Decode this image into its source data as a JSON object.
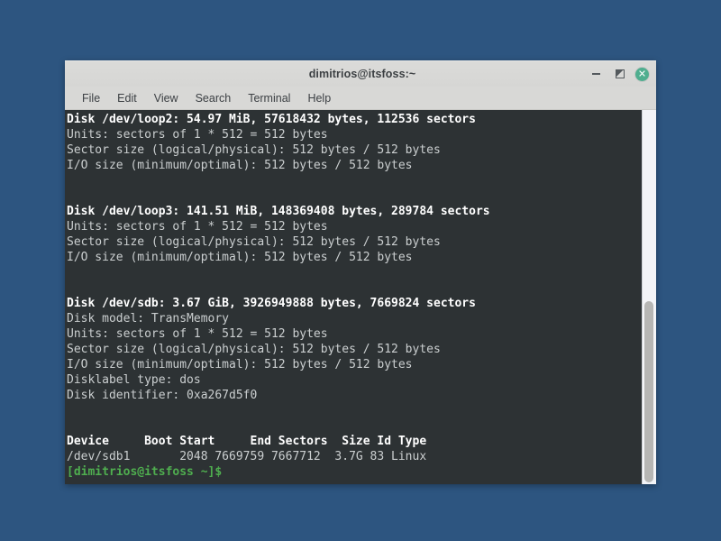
{
  "desktop": {
    "background_color": "#2d5580"
  },
  "window": {
    "title": "dimitrios@itsfoss:~",
    "titlebar_color": "#d8d8d6",
    "controls": {
      "minimize_label": "–",
      "maximize_label": "◤",
      "close_label": "✕",
      "close_color": "#4fae8f"
    },
    "menubar": {
      "items": [
        {
          "label": "File"
        },
        {
          "label": "Edit"
        },
        {
          "label": "View"
        },
        {
          "label": "Search"
        },
        {
          "label": "Terminal"
        },
        {
          "label": "Help"
        }
      ]
    }
  },
  "terminal": {
    "background_color": "#2d3234",
    "foreground_color": "#cfd2d2",
    "prompt_color": "#4fae4f",
    "lines": [
      {
        "text": "Disk /dev/loop2: 54.97 MiB, 57618432 bytes, 112536 sectors",
        "style": "bold-white"
      },
      {
        "text": "Units: sectors of 1 * 512 = 512 bytes",
        "style": "dim"
      },
      {
        "text": "Sector size (logical/physical): 512 bytes / 512 bytes",
        "style": "dim"
      },
      {
        "text": "I/O size (minimum/optimal): 512 bytes / 512 bytes",
        "style": "dim"
      },
      {
        "text": "",
        "style": "blank"
      },
      {
        "text": "",
        "style": "blank"
      },
      {
        "text": "Disk /dev/loop3: 141.51 MiB, 148369408 bytes, 289784 sectors",
        "style": "bold-white"
      },
      {
        "text": "Units: sectors of 1 * 512 = 512 bytes",
        "style": "dim"
      },
      {
        "text": "Sector size (logical/physical): 512 bytes / 512 bytes",
        "style": "dim"
      },
      {
        "text": "I/O size (minimum/optimal): 512 bytes / 512 bytes",
        "style": "dim"
      },
      {
        "text": "",
        "style": "blank"
      },
      {
        "text": "",
        "style": "blank"
      },
      {
        "text": "Disk /dev/sdb: 3.67 GiB, 3926949888 bytes, 7669824 sectors",
        "style": "bold-white"
      },
      {
        "text": "Disk model: TransMemory",
        "style": "dim"
      },
      {
        "text": "Units: sectors of 1 * 512 = 512 bytes",
        "style": "dim"
      },
      {
        "text": "Sector size (logical/physical): 512 bytes / 512 bytes",
        "style": "dim"
      },
      {
        "text": "I/O size (minimum/optimal): 512 bytes / 512 bytes",
        "style": "dim"
      },
      {
        "text": "Disklabel type: dos",
        "style": "dim"
      },
      {
        "text": "Disk identifier: 0xa267d5f0",
        "style": "dim"
      },
      {
        "text": "",
        "style": "blank"
      },
      {
        "text": "",
        "style": "blank"
      },
      {
        "text": "Device     Boot Start     End Sectors  Size Id Type",
        "style": "bold-white"
      },
      {
        "text": "/dev/sdb1       2048 7669759 7667712  3.7G 83 Linux",
        "style": "dim"
      },
      {
        "text": "[dimitrios@itsfoss ~]$",
        "style": "prompt"
      }
    ],
    "disks": [
      {
        "device": "/dev/loop2",
        "size": "54.97 MiB",
        "bytes": 57618432,
        "sectors": 112536,
        "units": "sectors of 1 * 512 = 512 bytes",
        "sector_size_logical": "512 bytes",
        "sector_size_physical": "512 bytes",
        "io_size_minimum": "512 bytes",
        "io_size_optimal": "512 bytes"
      },
      {
        "device": "/dev/loop3",
        "size": "141.51 MiB",
        "bytes": 148369408,
        "sectors": 289784,
        "units": "sectors of 1 * 512 = 512 bytes",
        "sector_size_logical": "512 bytes",
        "sector_size_physical": "512 bytes",
        "io_size_minimum": "512 bytes",
        "io_size_optimal": "512 bytes"
      },
      {
        "device": "/dev/sdb",
        "size": "3.67 GiB",
        "bytes": 3926949888,
        "sectors": 7669824,
        "model": "TransMemory",
        "units": "sectors of 1 * 512 = 512 bytes",
        "sector_size_logical": "512 bytes",
        "sector_size_physical": "512 bytes",
        "io_size_minimum": "512 bytes",
        "io_size_optimal": "512 bytes",
        "disklabel_type": "dos",
        "disk_identifier": "0xa267d5f0"
      }
    ],
    "partition_table": {
      "headers": [
        "Device",
        "Boot",
        "Start",
        "End",
        "Sectors",
        "Size",
        "Id",
        "Type"
      ],
      "rows": [
        {
          "Device": "/dev/sdb1",
          "Boot": "",
          "Start": "2048",
          "End": "7669759",
          "Sectors": "7667712",
          "Size": "3.7G",
          "Id": "83",
          "Type": "Linux"
        }
      ]
    },
    "prompt": "[dimitrios@itsfoss ~]$"
  },
  "scrollbar": {
    "orientation": "vertical",
    "thumb_position": "bottom"
  }
}
